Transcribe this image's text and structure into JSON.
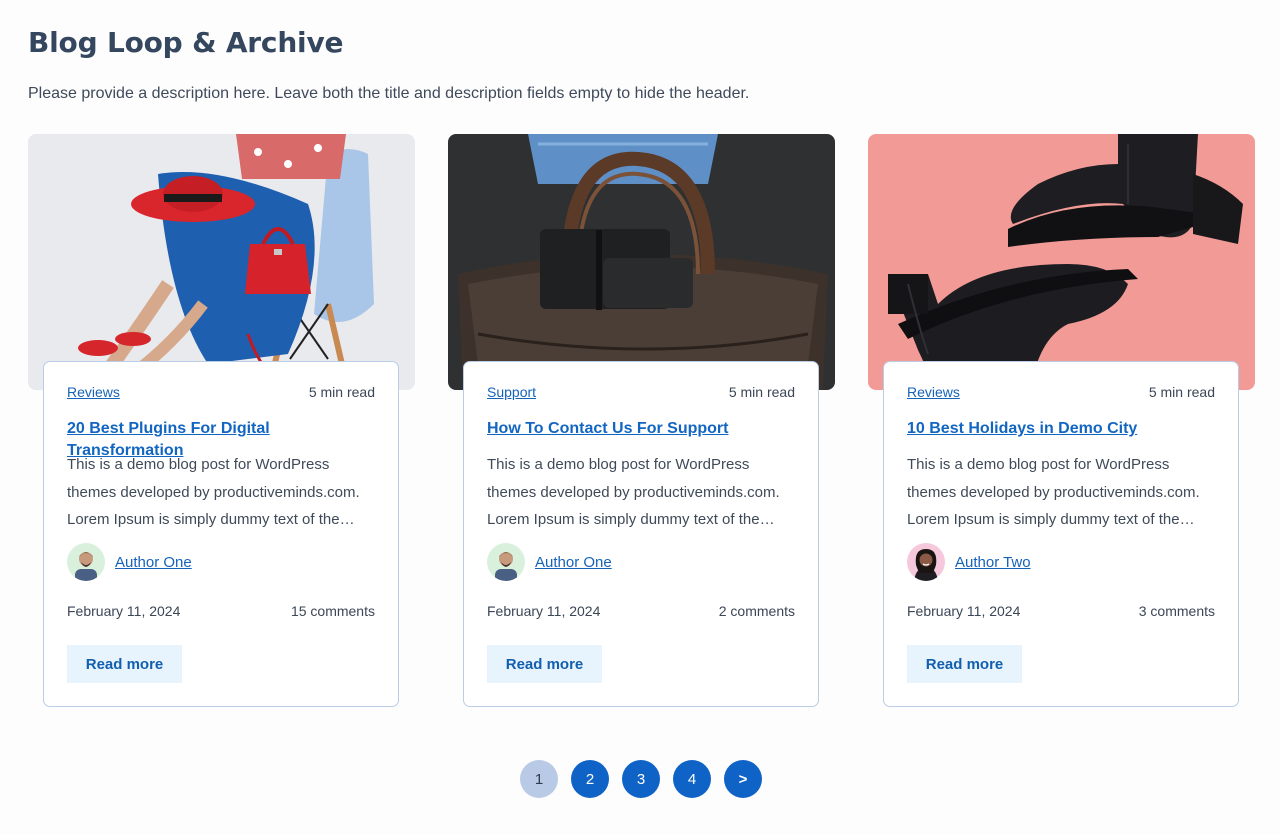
{
  "header": {
    "title": "Blog Loop & Archive",
    "description": "Please provide a description here. Leave both the title and description fields empty to hide the header."
  },
  "colors": {
    "accent": "#0f63c6",
    "link": "#1563b8",
    "card_border": "#b9cde6",
    "button_bg": "#e8f4fd",
    "pagination_current": "#b8cae6"
  },
  "posts": [
    {
      "category": "Reviews",
      "read_time": "5 min read",
      "title": "20 Best Plugins For Digital Transformation",
      "excerpt": "This is a demo blog post for WordPress themes developed by productiveminds.com. Lorem Ipsum is simply dummy text of the…",
      "author": "Author One",
      "avatar_icon": "avatar-man-icon",
      "date": "February 11, 2024",
      "comments": "15 comments",
      "read_more": "Read more"
    },
    {
      "category": "Support",
      "read_time": "5 min read",
      "title": "How To Contact Us For Support",
      "excerpt": "This is a demo blog post for WordPress themes developed by productiveminds.com. Lorem Ipsum is simply dummy text of the…",
      "author": "Author One",
      "avatar_icon": "avatar-man-icon",
      "date": "February 11, 2024",
      "comments": "2 comments",
      "read_more": "Read more"
    },
    {
      "category": "Reviews",
      "read_time": "5 min read",
      "title": "10 Best Holidays in Demo City",
      "excerpt": "This is a demo blog post for WordPress themes developed by productiveminds.com. Lorem Ipsum is simply dummy text of the…",
      "author": "Author Two",
      "avatar_icon": "avatar-woman-icon",
      "date": "February 11, 2024",
      "comments": "3 comments",
      "read_more": "Read more"
    }
  ],
  "pagination": {
    "pages": [
      "1",
      "2",
      "3",
      "4"
    ],
    "current": "1",
    "next_label": ">"
  }
}
